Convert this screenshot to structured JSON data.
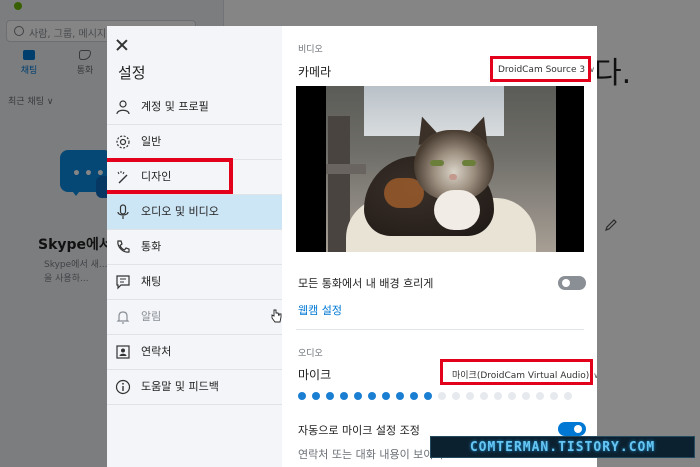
{
  "background": {
    "search_placeholder": "사람, 그룹, 메시지",
    "more_glyph": "···",
    "tabs": [
      {
        "label": "채팅",
        "icon": "chat-icon",
        "active": true
      },
      {
        "label": "통화",
        "icon": "phone-icon",
        "active": false
      }
    ],
    "recent_label": "최근 채팅",
    "recent_chevron": "∨",
    "welcome_title": "Skype에서",
    "welcome_subtitle": "Skype에서 새... 색을 사용하...",
    "heading_tail": "다."
  },
  "modal": {
    "title": "설정",
    "nav_items": [
      {
        "label": "계정 및 프로필",
        "icon": "person-icon"
      },
      {
        "label": "일반",
        "icon": "gear-icon"
      },
      {
        "label": "디자인",
        "icon": "magic-wand-icon"
      },
      {
        "label": "오디오 및 비디오",
        "icon": "microphone-icon",
        "active": true
      },
      {
        "label": "통화",
        "icon": "phone-icon"
      },
      {
        "label": "채팅",
        "icon": "chat-icon"
      },
      {
        "label": "알림",
        "icon": "bell-icon",
        "muted": true
      },
      {
        "label": "연락처",
        "icon": "contacts-icon"
      },
      {
        "label": "도움말 및 피드백",
        "icon": "info-icon"
      }
    ],
    "video": {
      "section_label": "비디오",
      "camera_label": "카메라",
      "camera_value": "DroidCam Source 3",
      "chevron": "∨",
      "blur_label": "모든 통화에서 내 배경 흐리게",
      "blur_on": false,
      "webcam_link": "웹캠 설정"
    },
    "audio": {
      "section_label": "오디오",
      "mic_label": "마이크",
      "mic_value": "마이크(DroidCam Virtual Audio)",
      "chevron": "∨",
      "level_active": 10,
      "level_total": 20,
      "auto_adjust_label": "자동으로 마이크 설정 조정",
      "auto_adjust_on": true,
      "bottom_text": "연락처 또는 대화 내용이 보이지"
    }
  },
  "colors": {
    "accent": "#0078d4",
    "highlight_box": "#e3001b",
    "active_nav": "#cde6f6"
  },
  "watermark": "COMTERMAN.TISTORY.COM"
}
